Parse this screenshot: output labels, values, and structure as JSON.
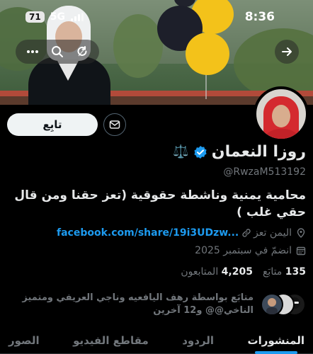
{
  "status_bar": {
    "time": "8:36",
    "battery": "71",
    "network": "5G"
  },
  "banner": {
    "icons": [
      "back-arrow-icon",
      "more-icon",
      "search-icon",
      "refresh-icon"
    ]
  },
  "profile": {
    "follow_label": "تابِع",
    "display_name": "روزا النعمان",
    "name_emoji": "⚖️",
    "handle": "@RwzaM513192",
    "bio": "محامية يمنية وناشطة حقوقية (تعز حقنا ومن قال حقي غلب )",
    "location": "اليمن تعز",
    "website": "facebook.com/share/19i3UDzw...",
    "joined": "انضمّ في سبتمبر 2025",
    "following_count": "135",
    "following_label": "متابَع",
    "followers_count": "4,205",
    "followers_label": "المتابعون",
    "followed_by": "متابَع بواسطة رهف اليافعيه وناجي العريفي ومتميز الناخي@@ و12 آخرين"
  },
  "tabs": [
    {
      "label": "المنشورات",
      "active": true
    },
    {
      "label": "الردود",
      "active": false
    },
    {
      "label": "مقاطع الفيديو",
      "active": false
    },
    {
      "label": "الصور",
      "active": false
    }
  ],
  "colors": {
    "accent": "#1d9bf0",
    "verified": "#1d9bf0",
    "background": "#000000"
  }
}
